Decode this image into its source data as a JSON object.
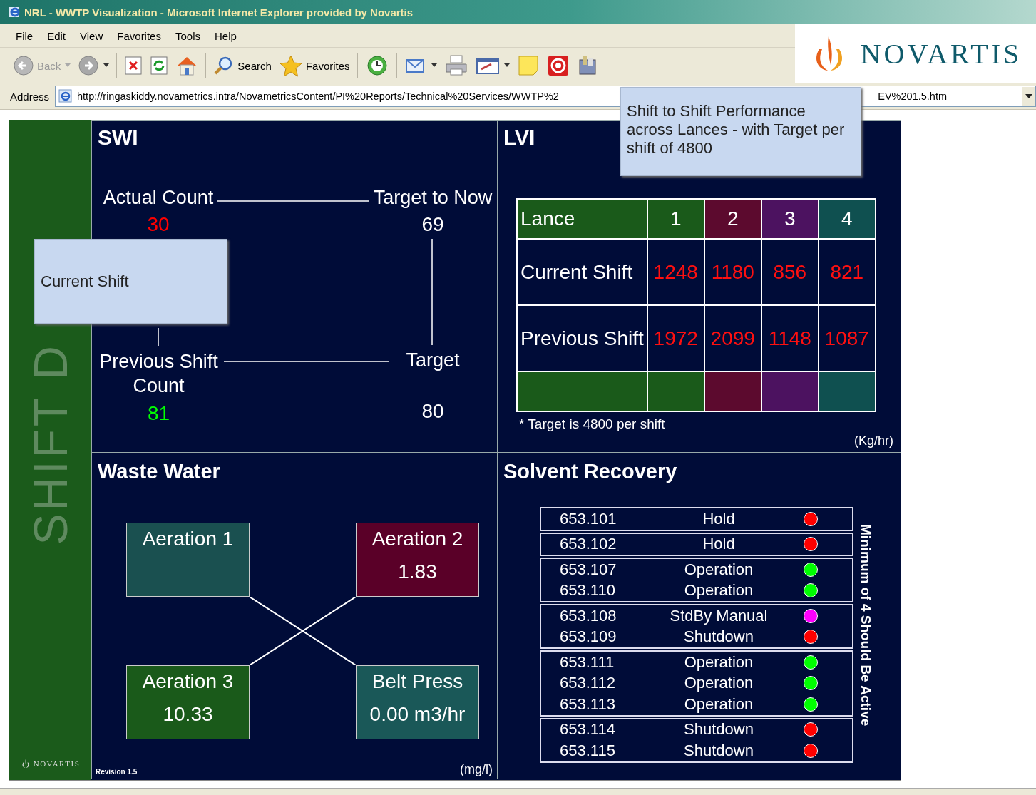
{
  "window": {
    "title": "NRL - WWTP Visualization - Microsoft Internet Explorer provided by Novartis"
  },
  "menu": [
    "File",
    "Edit",
    "View",
    "Favorites",
    "Tools",
    "Help"
  ],
  "toolbar": [
    {
      "kind": "back",
      "label": "Back"
    },
    {
      "kind": "forward"
    },
    {
      "kind": "stop"
    },
    {
      "kind": "refresh"
    },
    {
      "kind": "home"
    },
    {
      "kind": "search",
      "label": "Search"
    },
    {
      "kind": "favorites",
      "label": "Favorites"
    },
    {
      "kind": "history"
    },
    {
      "kind": "mail"
    },
    {
      "kind": "print"
    },
    {
      "kind": "edit"
    },
    {
      "kind": "note"
    },
    {
      "kind": "record"
    },
    {
      "kind": "research"
    }
  ],
  "brand": {
    "name": "NOVARTIS"
  },
  "address": {
    "label": "Address",
    "url_start": "http://ringaskiddy.novametrics.intra/NovametricsContent/PI%20Reports/Technical%20Services/WWTP%2",
    "url_end": "EV%201.5.htm"
  },
  "sidebar": {
    "shift": "SHIFT D",
    "brand": "NOVARTIS"
  },
  "swi": {
    "title": "SWI",
    "metrics": [
      {
        "label": "Actual Count",
        "value": "30",
        "color": "#ff0000"
      },
      {
        "label": "Target to Now",
        "value": "69",
        "color": "#ffffff"
      },
      {
        "label": "Previous Shift Count",
        "value": "81",
        "color": "#00ff00"
      },
      {
        "label": "Target",
        "value": "80",
        "color": "#ffffff"
      }
    ]
  },
  "current_tooltip": "Current Shift",
  "lvi": {
    "title": "LVI",
    "columns": [
      {
        "label": "Lance",
        "color": "#1a5a1a"
      },
      {
        "label": "1",
        "color": "#1a5a1a"
      },
      {
        "label": "2",
        "color": "#5c0a2e"
      },
      {
        "label": "3",
        "color": "#4c1260"
      },
      {
        "label": "4",
        "color": "#0f5050"
      }
    ],
    "rows": [
      {
        "label": "Current Shift",
        "values": [
          "1248",
          "1180",
          "856",
          "821"
        ]
      },
      {
        "label": "Previous Shift",
        "values": [
          "1972",
          "2099",
          "1148",
          "1087"
        ]
      }
    ],
    "note": "* Target is 4800 per shift",
    "unit": "(Kg/hr)"
  },
  "lvi_tooltip": "Shift to Shift Performance across Lances - with Target per shift of 4800",
  "waste_water": {
    "title": "Waste Water",
    "units": [
      {
        "name": "Aeration 1",
        "color": "#1a5050"
      },
      {
        "name": "Aeration 2",
        "value": "1.83",
        "color": "#5a0028"
      },
      {
        "name": "Aeration 3",
        "value": "10.33",
        "color": "#1a5a1a"
      },
      {
        "name": "Belt Press",
        "value": "0.00 m3/hr",
        "color": "#1a5858"
      }
    ],
    "revision": "Revision 1.5",
    "unit": "(mg/l)"
  },
  "solvent": {
    "title": "Solvent Recovery",
    "note": "Minimum of 4 Should Be Active",
    "groups": [
      {
        "rows": [
          {
            "id": "653.101",
            "status": "Hold",
            "color": "#ff0000"
          }
        ]
      },
      {
        "rows": [
          {
            "id": "653.102",
            "status": "Hold",
            "color": "#ff0000"
          }
        ]
      },
      {
        "rows": [
          {
            "id": "653.107",
            "status": "Operation",
            "color": "#00ff00"
          },
          {
            "id": "653.110",
            "status": "Operation",
            "color": "#00ff00"
          }
        ]
      },
      {
        "rows": [
          {
            "id": "653.108",
            "status": "StdBy Manual",
            "color": "#ff00ff"
          },
          {
            "id": "653.109",
            "status": "Shutdown",
            "color": "#ff0000"
          }
        ]
      },
      {
        "rows": [
          {
            "id": "653.111",
            "status": "Operation",
            "color": "#00ff00"
          },
          {
            "id": "653.112",
            "status": "Operation",
            "color": "#00ff00"
          },
          {
            "id": "653.113",
            "status": "Operation",
            "color": "#00ff00"
          }
        ]
      },
      {
        "rows": [
          {
            "id": "653.114",
            "status": "Shutdown",
            "color": "#ff0000"
          },
          {
            "id": "653.115",
            "status": "Shutdown",
            "color": "#ff0000"
          }
        ]
      }
    ]
  }
}
